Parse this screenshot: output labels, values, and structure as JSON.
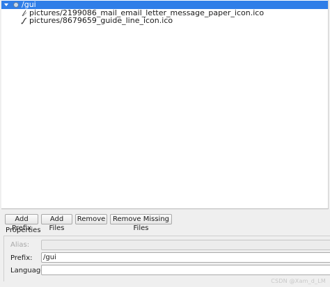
{
  "tree": {
    "prefix": "/gui",
    "files": [
      "pictures/2199086_mail_email_letter_message_paper_icon.ico",
      "pictures/8679659_guide_line_icon.ico"
    ]
  },
  "toolbar": {
    "add_prefix": "Add Prefix",
    "add_files": "Add Files",
    "remove": "Remove",
    "remove_missing": "Remove Missing Files"
  },
  "properties": {
    "title": "Properties",
    "alias_label": "Alias:",
    "alias_value": "",
    "prefix_label": "Prefix:",
    "prefix_value": "/gui",
    "language_label": "Language:",
    "language_value": ""
  },
  "colors": {
    "selection": "#2f7ee8"
  },
  "watermark": "CSDN @Xam_d_LM"
}
